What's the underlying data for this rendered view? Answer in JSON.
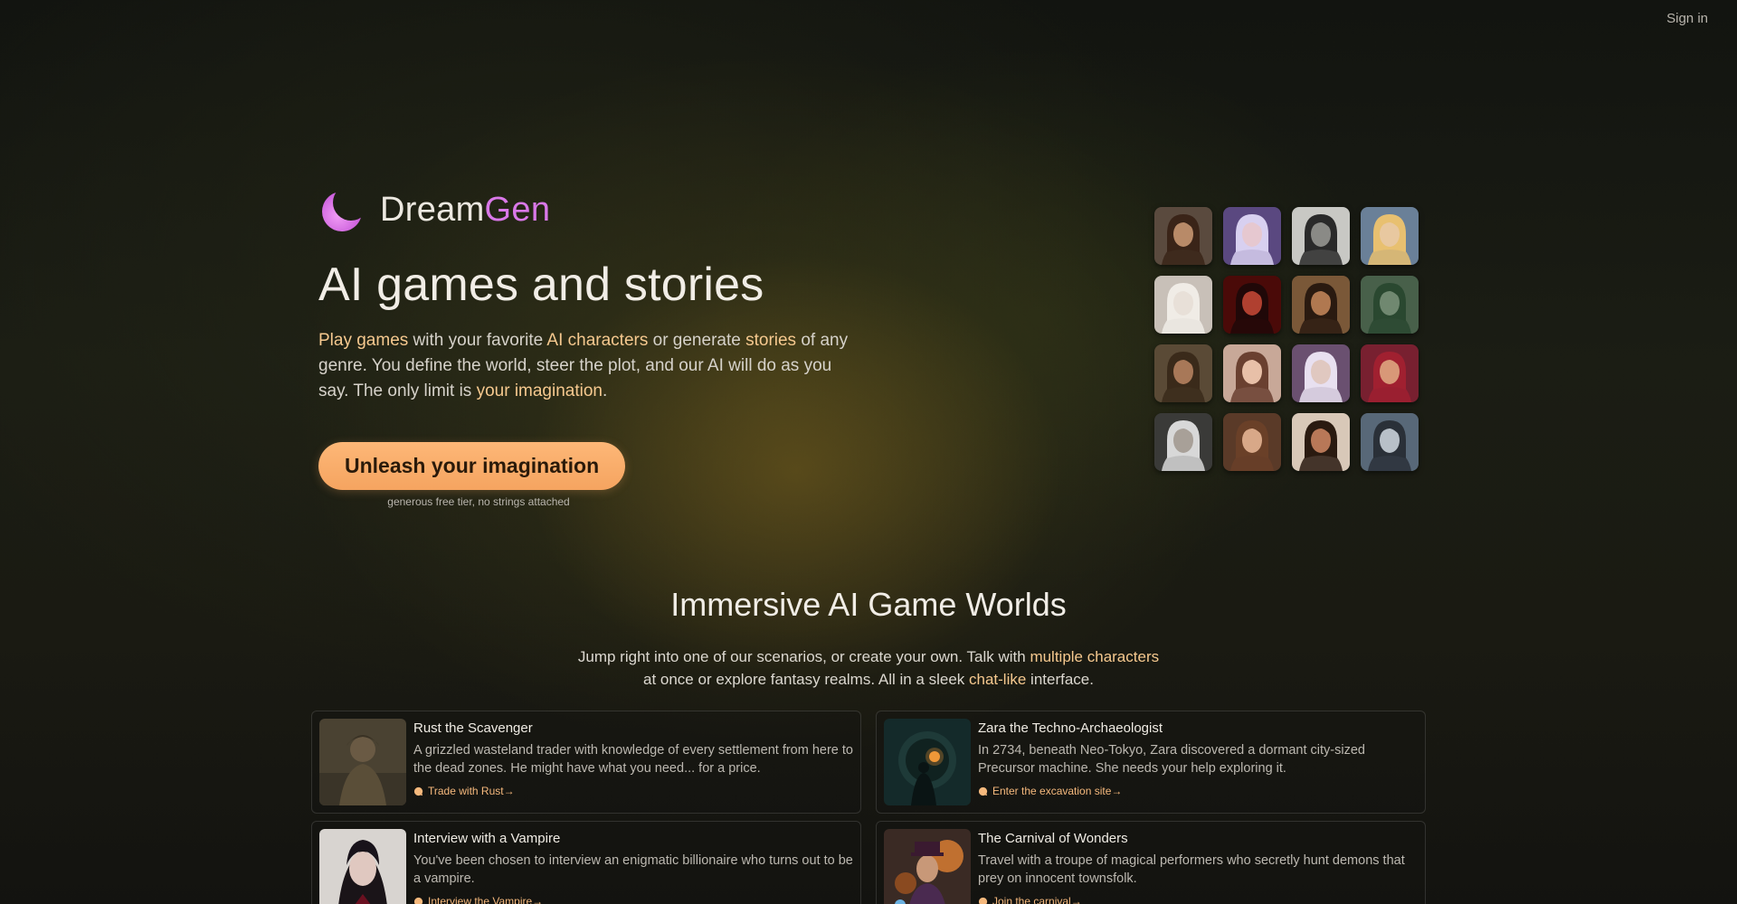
{
  "header": {
    "signin_label": "Sign in"
  },
  "brand": {
    "name_part1": "Dream",
    "name_part2": "Gen",
    "accent": "#d978e8"
  },
  "hero": {
    "title": "AI games and stories",
    "desc": {
      "p1": "Play games",
      "p2": " with your favorite ",
      "p3": "AI characters",
      "p4": " or generate ",
      "p5": "stories",
      "p6": " of any genre. You define the world, steer the plot, and our AI will do as you say. The only limit is ",
      "p7": "your imagination",
      "p8": "."
    },
    "cta_label": "Unleash your imagination",
    "cta_note": "generous free tier, no strings attached",
    "cta_color": "#fdb777"
  },
  "avatars": [
    {
      "name": "avatar-1",
      "skin": "#b88a68",
      "hair": "#3a2418",
      "bg": "#5a4a3e"
    },
    {
      "name": "avatar-2",
      "skin": "#e6c8d0",
      "hair": "#d8d0f0",
      "bg": "#5a4880"
    },
    {
      "name": "avatar-3",
      "skin": "#8a8a86",
      "hair": "#2a2a2a",
      "bg": "#c8c8c4"
    },
    {
      "name": "avatar-4",
      "skin": "#e8c8a0",
      "hair": "#e8c070",
      "bg": "#6a8098"
    },
    {
      "name": "avatar-5",
      "skin": "#e8e0d8",
      "hair": "#f0ece6",
      "bg": "#c8c0b8"
    },
    {
      "name": "avatar-6",
      "skin": "#b04030",
      "hair": "#200808",
      "bg": "#4a0a08"
    },
    {
      "name": "avatar-7",
      "skin": "#b07850",
      "hair": "#2a1a10",
      "bg": "#7a5838"
    },
    {
      "name": "avatar-8",
      "skin": "#708870",
      "hair": "#2a4830",
      "bg": "#48604a"
    },
    {
      "name": "avatar-9",
      "skin": "#a87858",
      "hair": "#3a2a1a",
      "bg": "#5a4a36"
    },
    {
      "name": "avatar-10",
      "skin": "#e8c0a8",
      "hair": "#6a4030",
      "bg": "#c8a898"
    },
    {
      "name": "avatar-11",
      "skin": "#e0c8c0",
      "hair": "#e8e0f0",
      "bg": "#6a5070"
    },
    {
      "name": "avatar-12",
      "skin": "#d89878",
      "hair": "#a02030",
      "bg": "#782030"
    },
    {
      "name": "avatar-13",
      "skin": "#a8a098",
      "hair": "#d8d8d8",
      "bg": "#3a3a38"
    },
    {
      "name": "avatar-14",
      "skin": "#d8a888",
      "hair": "#6a4028",
      "bg": "#5a3a28"
    },
    {
      "name": "avatar-15",
      "skin": "#b87858",
      "hair": "#2a1a10",
      "bg": "#d8c8b8"
    },
    {
      "name": "avatar-16",
      "skin": "#b8c0c8",
      "hair": "#2a3038",
      "bg": "#586878"
    }
  ],
  "section": {
    "title": "Immersive AI Game Worlds",
    "desc": {
      "p1": "Jump right into one of our scenarios, or create your own. Talk with ",
      "p2": "multiple characters",
      "p3": "at once or explore fantasy realms. All in a sleek ",
      "p4": "chat-like",
      "p5": " interface."
    }
  },
  "cards": [
    {
      "title": "Rust the Scavenger",
      "desc": "A grizzled wasteland trader with knowledge of every settlement from here to the dead zones. He might have what you need... for a price.",
      "link": "Trade with Rust→"
    },
    {
      "title": "Zara the Techno-Archaeologist",
      "desc": "In 2734, beneath Neo-Tokyo, Zara discovered a dormant city-sized Precursor machine. She needs your help exploring it.",
      "link": "Enter the excavation site→"
    },
    {
      "title": "Interview with a Vampire",
      "desc": "You've been chosen to interview an enigmatic billionaire who turns out to be a vampire.",
      "link": "Interview the Vampire→"
    },
    {
      "title": "The Carnival of Wonders",
      "desc": "Travel with a troupe of magical performers who secretly hunt demons that prey on innocent townsfolk.",
      "link": "Join the carnival→"
    }
  ]
}
